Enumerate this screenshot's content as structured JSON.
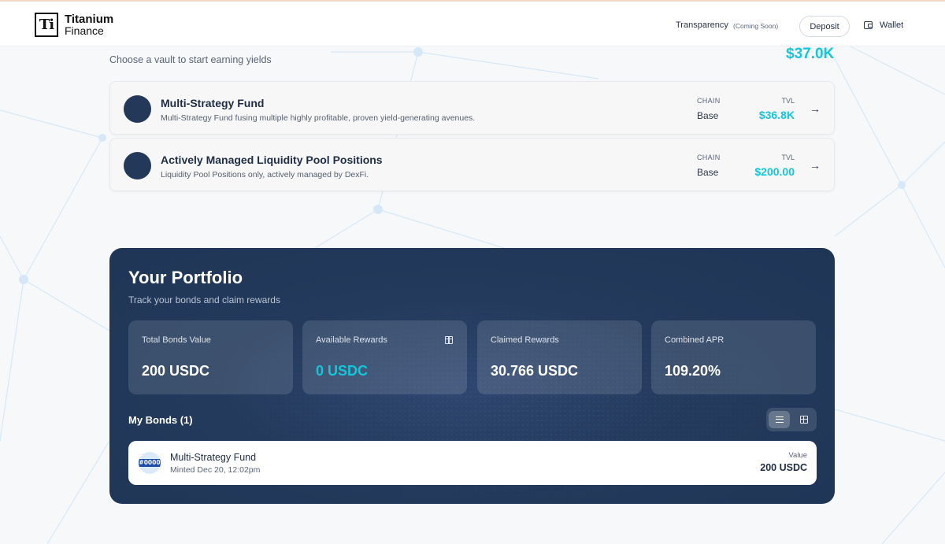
{
  "header": {
    "logo_glyph": "Ti",
    "logo_line1": "Titanium",
    "logo_line2": "Finance",
    "nav_transparency": "Transparency",
    "nav_coming_soon": "(Coming Soon)",
    "deposit_label": "Deposit",
    "wallet_label": "Wallet"
  },
  "vaults": {
    "subtitle": "Choose a vault to start earning yields",
    "total_tvl": "$37.0K",
    "items": [
      {
        "name": "Multi-Strategy Fund",
        "description": "Multi-Strategy Fund fusing multiple highly profitable, proven yield-generating avenues.",
        "chain_label": "CHAIN",
        "chain": "Base",
        "tvl_label": "TVL",
        "tvl": "$36.8K",
        "arrow": "→"
      },
      {
        "name": "Actively Managed Liquidity Pool Positions",
        "description": "Liquidity Pool Positions only, actively managed by DexFi.",
        "chain_label": "CHAIN",
        "chain": "Base",
        "tvl_label": "TVL",
        "tvl": "$200.00",
        "arrow": "→"
      }
    ]
  },
  "portfolio": {
    "title": "Your Portfolio",
    "subtitle": "Track your bonds and claim rewards",
    "stats": [
      {
        "label": "Total Bonds Value",
        "value": "200 USDC"
      },
      {
        "label": "Available Rewards",
        "value": "0 USDC",
        "icon": "gift-icon"
      },
      {
        "label": "Claimed Rewards",
        "value": "30.766 USDC"
      },
      {
        "label": "Combined APR",
        "value": "109.20%"
      }
    ],
    "bonds_title": "My Bonds (1)",
    "view_modes": [
      "list",
      "grid"
    ],
    "active_view": "list",
    "bonds": [
      {
        "badge": "#0000",
        "name": "Multi-Strategy Fund",
        "minted": "Minted Dec 20, 12:02pm",
        "value_label": "Value",
        "value": "200 USDC"
      }
    ]
  },
  "colors": {
    "accent": "#13c6d8",
    "navy": "#24395a",
    "text": "#1f2d44"
  }
}
